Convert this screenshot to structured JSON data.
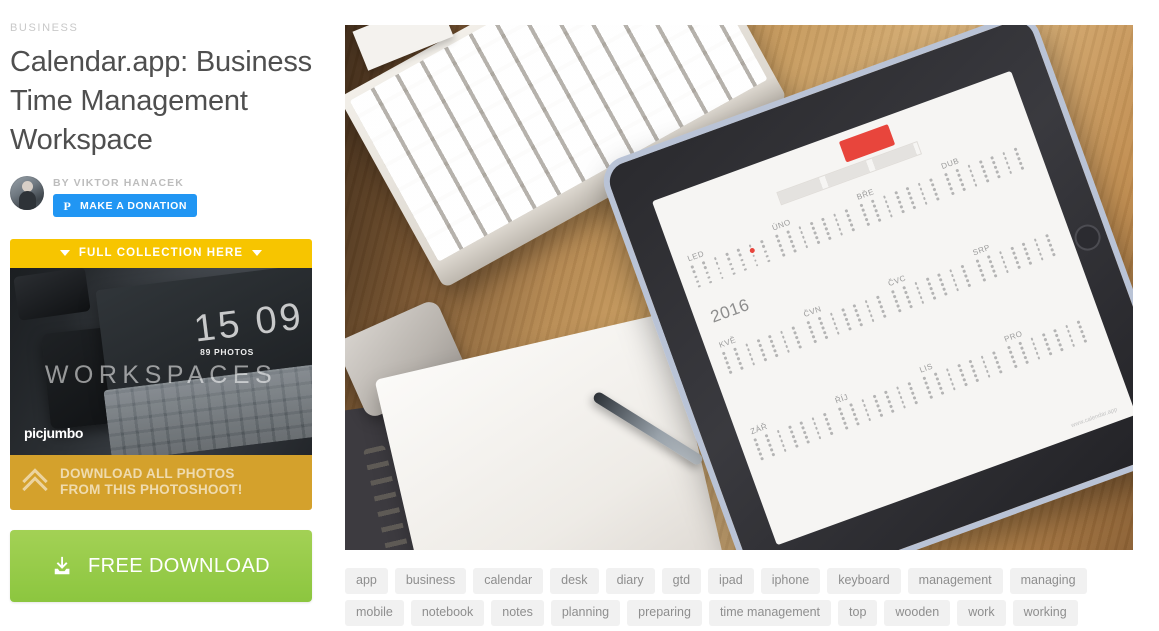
{
  "sidebar": {
    "category": "BUSINESS",
    "title": "Calendar.app: Business Time Management Workspace",
    "author": {
      "by_line": "BY VIKTOR HANACEK",
      "donate_label": "MAKE A DONATION",
      "paypal_glyph": "P"
    },
    "promo": {
      "header_label": "FULL COLLECTION HERE",
      "collection_name": "WORKSPACES",
      "photo_count_badge": "89 PHOTOS",
      "watermark": "picjumbo",
      "screen_numbers": "15 09",
      "footer_line1": "DOWNLOAD ALL PHOTOS",
      "footer_line2": "FROM THIS PHOTOSHOOT!"
    },
    "download_label": "FREE DOWNLOAD"
  },
  "main": {
    "hero_alt": "Tablet showing yearly calendar app on wooden desk with keyboard, notebook, pen and iphone",
    "calendar": {
      "year": "2016",
      "months": [
        "LED",
        "ÚNO",
        "BŘE",
        "DUB",
        "KVĚ",
        "ČVN",
        "ČVC",
        "SRP",
        "ZÁŘ",
        "ŘÍJ",
        "LIS",
        "PRO"
      ],
      "footer_note": "www.calendar.app"
    },
    "tags": [
      "app",
      "business",
      "calendar",
      "desk",
      "diary",
      "gtd",
      "ipad",
      "iphone",
      "keyboard",
      "management",
      "managing",
      "mobile",
      "notebook",
      "notes",
      "planning",
      "preparing",
      "time management",
      "top",
      "wooden",
      "work",
      "working"
    ]
  },
  "colors": {
    "yellow": "#F7C500",
    "gold": "#D4A12C",
    "green": "#8CC63F",
    "paypal_blue": "#2196F3",
    "tag_bg": "#f1f1f1",
    "title_text": "#4f4f4f"
  }
}
